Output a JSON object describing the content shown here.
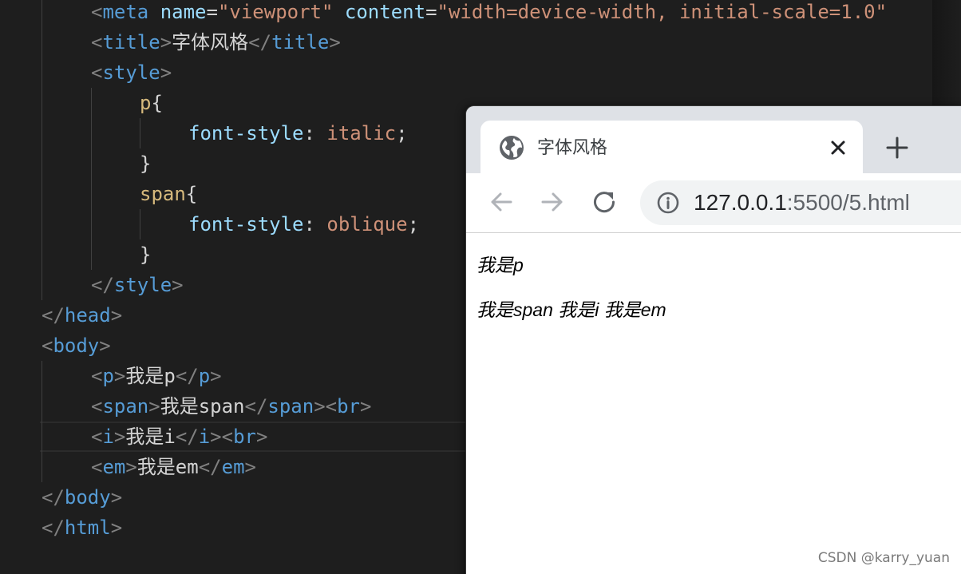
{
  "editor": {
    "lines": [
      [
        [
          "<",
          "punc"
        ],
        [
          "meta",
          "tag"
        ],
        [
          " ",
          "text"
        ],
        [
          "name",
          "attr"
        ],
        [
          "=",
          "text"
        ],
        [
          "\"viewport\"",
          "str"
        ],
        [
          " ",
          "text"
        ],
        [
          "content",
          "attr"
        ],
        [
          "=",
          "text"
        ],
        [
          "\"width=device-width, initial-scale=1.0\"",
          "str"
        ]
      ],
      [
        [
          "<",
          "punc"
        ],
        [
          "title",
          "tag"
        ],
        [
          ">",
          "punc"
        ],
        [
          "字体风格",
          "text"
        ],
        [
          "</",
          "punc"
        ],
        [
          "title",
          "tag"
        ],
        [
          ">",
          "punc"
        ]
      ],
      [
        [
          "<",
          "punc"
        ],
        [
          "style",
          "tag"
        ],
        [
          ">",
          "punc"
        ]
      ],
      [
        [
          "p",
          "sel"
        ],
        [
          "{",
          "text"
        ]
      ],
      [
        [
          "font-style",
          "prop"
        ],
        [
          ": ",
          "text"
        ],
        [
          "italic",
          "val"
        ],
        [
          ";",
          "text"
        ]
      ],
      [
        [
          "}",
          "text"
        ]
      ],
      [
        [
          "span",
          "sel"
        ],
        [
          "{",
          "text"
        ]
      ],
      [
        [
          "font-style",
          "prop"
        ],
        [
          ": ",
          "text"
        ],
        [
          "oblique",
          "val"
        ],
        [
          ";",
          "text"
        ]
      ],
      [
        [
          "}",
          "text"
        ]
      ],
      [
        [
          "</",
          "punc"
        ],
        [
          "style",
          "tag"
        ],
        [
          ">",
          "punc"
        ]
      ],
      [
        [
          "</",
          "punc"
        ],
        [
          "head",
          "tag"
        ],
        [
          ">",
          "punc"
        ]
      ],
      [
        [
          "<",
          "punc"
        ],
        [
          "body",
          "tag"
        ],
        [
          ">",
          "punc"
        ]
      ],
      [
        [
          "<",
          "punc"
        ],
        [
          "p",
          "tag"
        ],
        [
          ">",
          "punc"
        ],
        [
          "我是p",
          "text"
        ],
        [
          "</",
          "punc"
        ],
        [
          "p",
          "tag"
        ],
        [
          ">",
          "punc"
        ]
      ],
      [
        [
          "<",
          "punc"
        ],
        [
          "span",
          "tag"
        ],
        [
          ">",
          "punc"
        ],
        [
          "我是span",
          "text"
        ],
        [
          "</",
          "punc"
        ],
        [
          "span",
          "tag"
        ],
        [
          ">",
          "punc"
        ],
        [
          "<",
          "punc"
        ],
        [
          "br",
          "tag"
        ],
        [
          ">",
          "punc"
        ]
      ],
      [
        [
          "<",
          "punc"
        ],
        [
          "i",
          "tag"
        ],
        [
          ">",
          "punc"
        ],
        [
          "我是i",
          "text"
        ],
        [
          "</",
          "punc"
        ],
        [
          "i",
          "tag"
        ],
        [
          ">",
          "punc"
        ],
        [
          "<",
          "punc"
        ],
        [
          "br",
          "tag"
        ],
        [
          ">",
          "punc"
        ]
      ],
      [
        [
          "<",
          "punc"
        ],
        [
          "em",
          "tag"
        ],
        [
          ">",
          "punc"
        ],
        [
          "我是em",
          "text"
        ],
        [
          "</",
          "punc"
        ],
        [
          "em",
          "tag"
        ],
        [
          ">",
          "punc"
        ]
      ],
      [
        [
          "</",
          "punc"
        ],
        [
          "body",
          "tag"
        ],
        [
          ">",
          "punc"
        ]
      ],
      [
        [
          "</",
          "punc"
        ],
        [
          "html",
          "tag"
        ],
        [
          ">",
          "punc"
        ]
      ]
    ]
  },
  "browser": {
    "tab_title": "字体风格",
    "url_host": "127.0.0.1",
    "url_rest": ":5500/5.html",
    "page_paragraph": "我是p",
    "page_line2": "我是span 我是i 我是em"
  },
  "watermark": "CSDN @karry_yuan",
  "colors": {
    "editor_bg": "#1e1e1e",
    "tag": "#569cd6",
    "attribute": "#9cdcfe",
    "string": "#ce9178",
    "selector": "#d7ba7d",
    "browser_tab_strip": "#dee1e6",
    "omnibox_bg": "#f1f3f4"
  },
  "icons": {
    "favicon": "globe-icon",
    "tab_close": "close-icon",
    "new_tab": "plus-icon",
    "back": "arrow-left-icon",
    "forward": "arrow-right-icon",
    "reload": "reload-icon",
    "site_info": "info-icon"
  }
}
